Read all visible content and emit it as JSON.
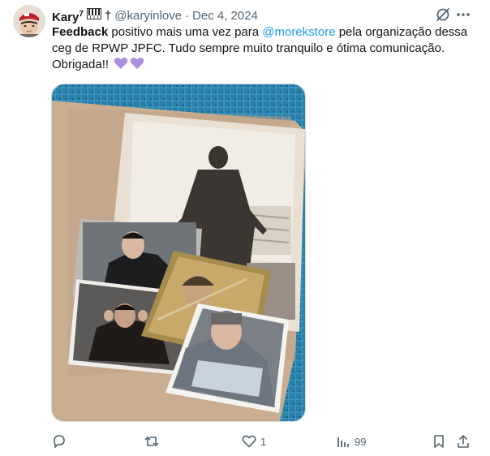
{
  "tweet": {
    "author_name": "Kary",
    "author_name_sup": "7",
    "dagger": "†",
    "handle": "@karyinlove",
    "separator": "·",
    "date": "Dec 4, 2024",
    "text_bold": "Feedback",
    "text_part1": " positivo mais uma vez para ",
    "mention": "@morekstore",
    "text_part2": " pela organização dessa ceg de RPWP JPFC. Tudo sempre muito tranquilo e ótima comunicação. Obrigada!! ",
    "emoji": [
      "purple-heart",
      "purple-heart"
    ]
  },
  "actions": {
    "reply_count": "",
    "retweet_count": "",
    "like_count": "1",
    "views_count": "99"
  },
  "colors": {
    "accent": "#1d9bf0",
    "muted": "#536471",
    "heart": "#ab91dc"
  }
}
